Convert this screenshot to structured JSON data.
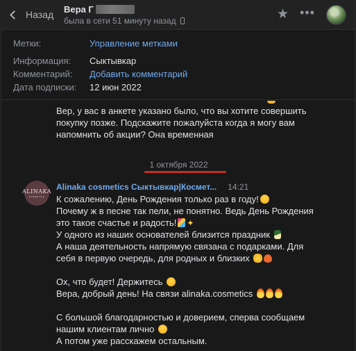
{
  "header": {
    "back_label": "Назад",
    "user_name": "Вера Г",
    "status": "была в сети 51 минуту назад"
  },
  "info": {
    "tags_label": "Метки:",
    "tags_link": "Управление метками",
    "info_label": "Информация:",
    "info_value": "Сыктывкар",
    "comment_label": "Комментарий:",
    "comment_link": "Добавить комментарий",
    "date_label": "Дата подписки:",
    "date_value": "12 июн 2022"
  },
  "messages": {
    "prev_lines": [
      "Вер, у вас в анкете указано было, что вы хотите совершить",
      "покупку позже. Подскажите пожалуйста когда я могу вам",
      "напомнить об акции? Она временная"
    ],
    "date_separator": "1 октября 2022",
    "sender": {
      "avatar_text": "ALINAKA",
      "avatar_subtext": "COSMETICS",
      "name": "Alinaka cosmetics Сыктывкар|Космет...",
      "time": "14:21"
    },
    "body": [
      "К сожалению, День Рождения только раз в году!",
      "Почему ж в песне так пели, не понятно. Ведь День Рождения",
      "это такое счастье и радость!",
      "У одного из наших основателей близится праздник",
      "А наша деятельность напрямую связана с подарками. Для",
      "себя в первую очередь, для родных и близких",
      "Ох, что будет! Держитесь",
      "Вера, добрый день! На связи alinaka.cosmetics",
      "С большой благодарностью и доверием, сперва сообщаем",
      "нашим клиентам лично",
      "А потом уже расскажем остальным."
    ]
  },
  "icons": {
    "back": "chevron-left-icon",
    "star": "star-icon",
    "more": "more-icon",
    "phone": "phone-icon"
  }
}
